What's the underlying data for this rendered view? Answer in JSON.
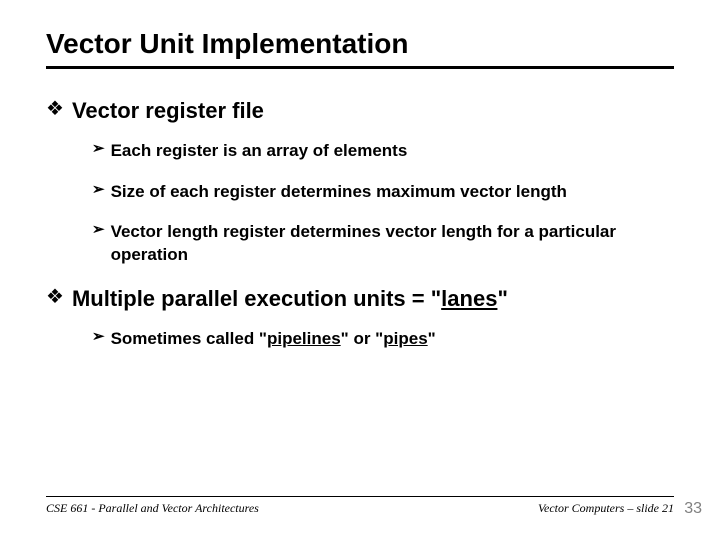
{
  "title": "Vector Unit Implementation",
  "bullets": {
    "b1": "Vector register file",
    "b1a": "Each register is an array of elements",
    "b1b": "Size of each register determines maximum vector length",
    "b1c": "Vector length register determines vector length for a particular operation",
    "b2_pre": "Multiple parallel execution units = \"",
    "b2_u": "lanes",
    "b2_post": "\"",
    "b2a_pre": "Sometimes called \"",
    "b2a_u1": "pipelines",
    "b2a_mid": "\" or \"",
    "b2a_u2": "pipes",
    "b2a_post": "\""
  },
  "markers": {
    "diamond": "❖",
    "arrow": "➢"
  },
  "footer": {
    "left": "CSE 661 - Parallel and Vector Architectures",
    "right": "Vector Computers – slide 21"
  },
  "pagenum": "33"
}
